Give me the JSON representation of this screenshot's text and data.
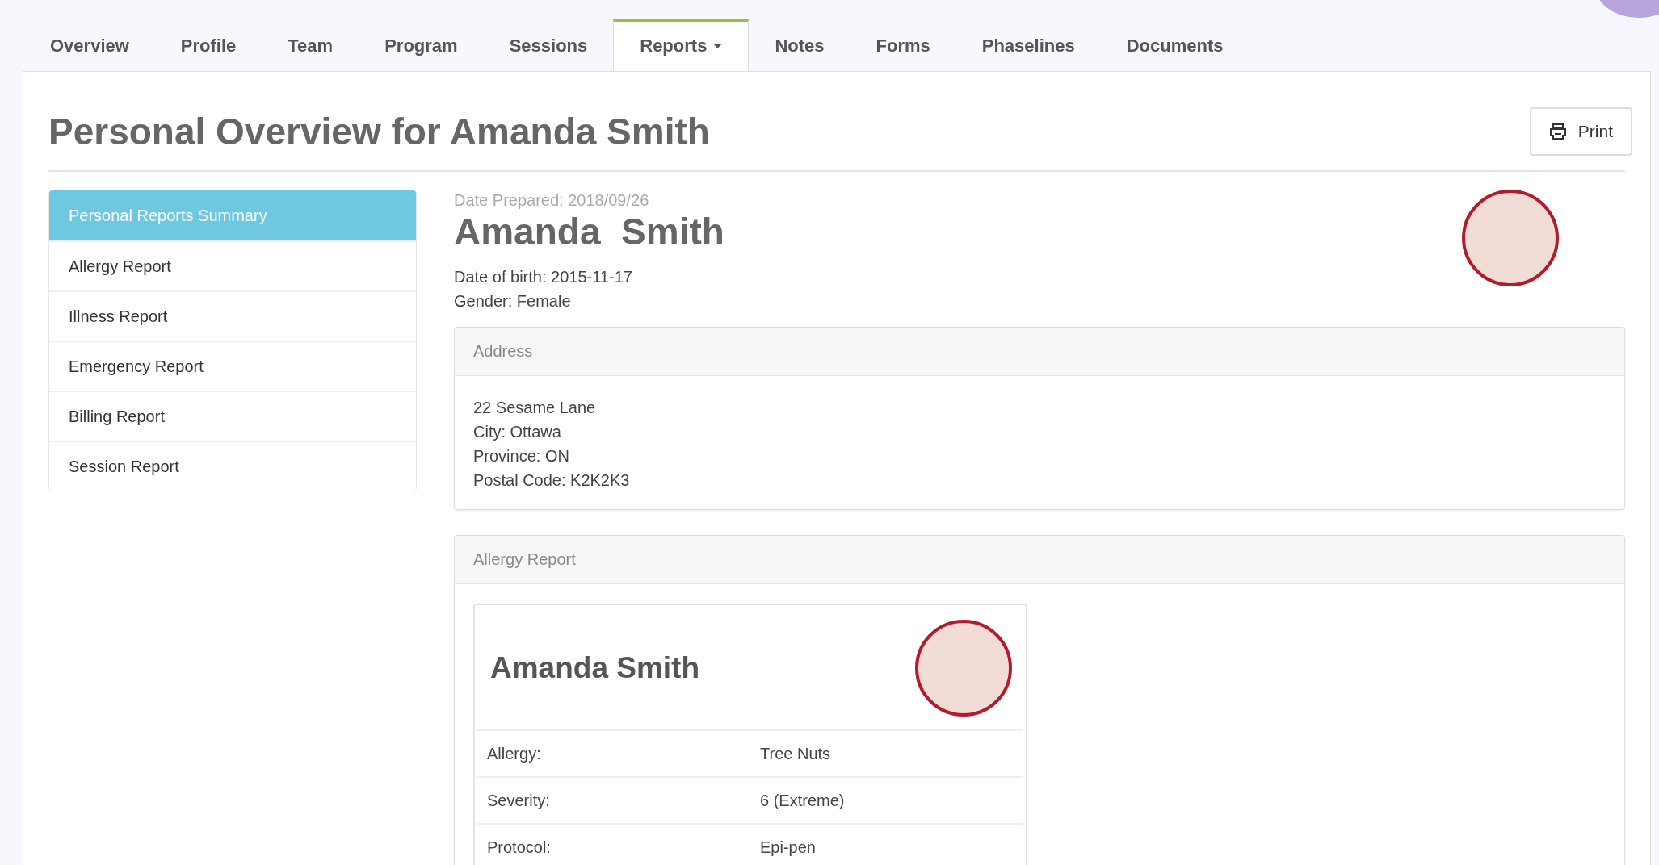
{
  "tabs": [
    {
      "label": "Overview",
      "selected": false,
      "dropdown": false
    },
    {
      "label": "Profile",
      "selected": false,
      "dropdown": false
    },
    {
      "label": "Team",
      "selected": false,
      "dropdown": false
    },
    {
      "label": "Program",
      "selected": false,
      "dropdown": false
    },
    {
      "label": "Sessions",
      "selected": false,
      "dropdown": false
    },
    {
      "label": "Reports",
      "selected": true,
      "dropdown": true
    },
    {
      "label": "Notes",
      "selected": false,
      "dropdown": false
    },
    {
      "label": "Forms",
      "selected": false,
      "dropdown": false
    },
    {
      "label": "Phaselines",
      "selected": false,
      "dropdown": false
    },
    {
      "label": "Documents",
      "selected": false,
      "dropdown": false
    }
  ],
  "page_title": "Personal Overview for Amanda Smith",
  "print_button": "Print",
  "sidebar": {
    "items": [
      {
        "label": "Personal Reports Summary",
        "selected": true
      },
      {
        "label": "Allergy Report",
        "selected": false
      },
      {
        "label": "Illness Report",
        "selected": false
      },
      {
        "label": "Emergency Report",
        "selected": false
      },
      {
        "label": "Billing Report",
        "selected": false
      },
      {
        "label": "Session Report",
        "selected": false
      }
    ]
  },
  "person": {
    "date_prepared": "Date Prepared: 2018/09/26",
    "name": "Amanda  Smith",
    "details": [
      "Date of birth: 2015-11-17",
      "Gender: Female"
    ]
  },
  "address": {
    "heading": "Address",
    "lines": [
      "22 Sesame Lane",
      "City: Ottawa",
      "Province: ON",
      "Postal Code: K2K2K3"
    ]
  },
  "allergy_report": {
    "heading": "Allergy Report",
    "card": {
      "name": "Amanda Smith",
      "rows": [
        {
          "label": "Allergy:",
          "value": "Tree Nuts"
        },
        {
          "label": "Severity:",
          "value": "6 (Extreme)"
        },
        {
          "label": "Protocol:",
          "value": "Epi-pen"
        }
      ]
    }
  }
}
